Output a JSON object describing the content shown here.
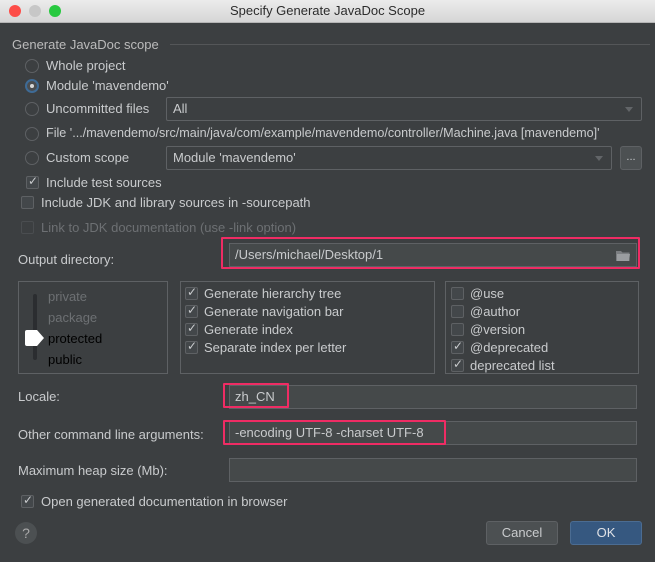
{
  "window": {
    "title": "Specify Generate JavaDoc Scope",
    "controls": [
      "close",
      "minimize",
      "zoom"
    ],
    "colors": {
      "close": "#fd4d48",
      "minimize": "#c7c7c7",
      "zoom": "#28c940"
    }
  },
  "scope": {
    "group_title": "Generate JavaDoc scope",
    "options": [
      {
        "label": "Whole project",
        "selected": false
      },
      {
        "label": "Module 'mavendemo'",
        "selected": true
      },
      {
        "label": "Uncommitted files",
        "selected": false,
        "combo_value": "All"
      },
      {
        "label": "File '.../mavendemo/src/main/java/com/example/mavendemo/controller/Machine.java [mavendemo]'",
        "selected": false
      },
      {
        "label": "Custom scope",
        "selected": false,
        "combo_value": "Module 'mavendemo'",
        "browse_label": "..."
      }
    ],
    "include_test_sources": {
      "label": "Include test sources",
      "checked": true
    },
    "include_jdk_sources": {
      "label": "Include JDK and library sources in -sourcepath",
      "checked": false
    },
    "link_jdk_docs": {
      "label": "Link to JDK documentation (use -link option)",
      "checked": false,
      "enabled": false
    }
  },
  "output_directory": {
    "label": "Output directory:",
    "value": "/Users/michael/Desktop/1",
    "icon": "folder-icon"
  },
  "visibility": {
    "levels": [
      "private",
      "package",
      "protected",
      "public"
    ],
    "selected": "protected"
  },
  "generate_options": [
    {
      "label": "Generate hierarchy tree",
      "checked": true
    },
    {
      "label": "Generate navigation bar",
      "checked": true
    },
    {
      "label": "Generate index",
      "checked": true
    },
    {
      "label": "Separate index per letter",
      "checked": true
    }
  ],
  "tag_options": [
    {
      "label": "@use",
      "checked": false
    },
    {
      "label": "@author",
      "checked": false
    },
    {
      "label": "@version",
      "checked": false
    },
    {
      "label": "@deprecated",
      "checked": true
    },
    {
      "label": "deprecated list",
      "checked": true
    }
  ],
  "locale": {
    "label": "Locale:",
    "value": "zh_CN"
  },
  "other_args": {
    "label": "Other command line arguments:",
    "value": "-encoding UTF-8 -charset UTF-8"
  },
  "max_heap": {
    "label": "Maximum heap size (Mb):",
    "value": ""
  },
  "open_in_browser": {
    "label": "Open generated documentation in browser",
    "checked": true
  },
  "buttons": {
    "help": "?",
    "cancel": "Cancel",
    "ok": "OK"
  },
  "highlight_color": "#ef2c64"
}
